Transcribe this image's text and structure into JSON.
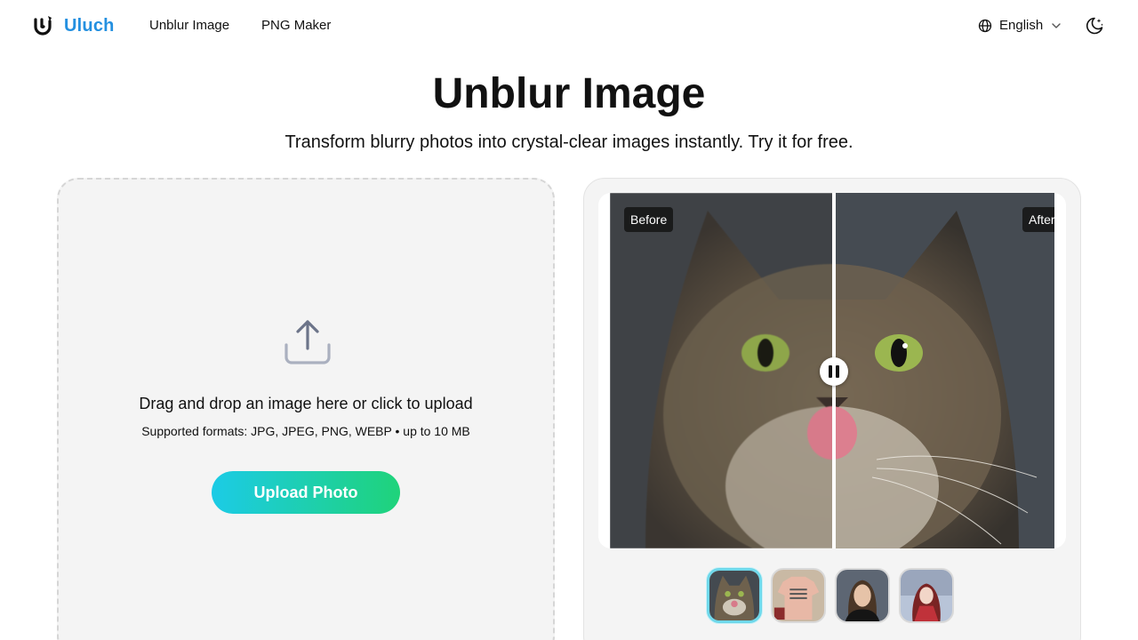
{
  "header": {
    "brand": "Uluch",
    "brand_color": "#2490e0",
    "nav": [
      {
        "label": "Unblur Image"
      },
      {
        "label": "PNG Maker"
      }
    ],
    "language": {
      "label": "English",
      "icon": "globe-icon"
    },
    "theme_icon": "moon-stars-icon"
  },
  "hero": {
    "title": "Unblur Image",
    "subtitle": "Transform blurry photos into crystal-clear images instantly. Try it for free."
  },
  "upload": {
    "icon": "upload-icon",
    "drop_text": "Drag and drop an image here or click to upload",
    "formats_text": "Supported formats: JPG, JPEG, PNG, WEBP • up to 10 MB",
    "button_label": "Upload Photo",
    "button_gradient": [
      "#1ccbe6",
      "#1fd37a"
    ]
  },
  "compare": {
    "before_label": "Before",
    "after_label": "After",
    "handle_icon": "pause-icon",
    "thumbnails": [
      {
        "name": "cat",
        "active": true
      },
      {
        "name": "t-shirt"
      },
      {
        "name": "woman-portrait"
      },
      {
        "name": "anime-girl"
      }
    ]
  }
}
